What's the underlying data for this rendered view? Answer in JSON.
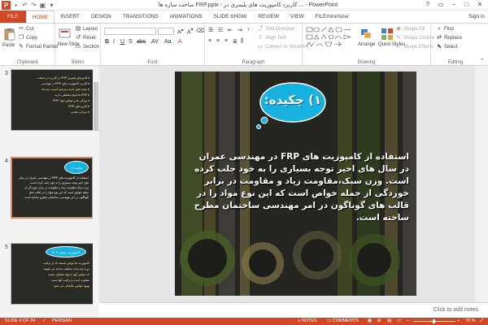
{
  "window": {
    "title": "ساخت سازه ها FRP.pptx - کاربرد کامپوزیت های پلیمری در ... - PowerPoint",
    "app_icon": "P"
  },
  "tabs": [
    "FILE",
    "HOME",
    "INSERT",
    "DESIGN",
    "TRANSITIONS",
    "ANIMATIONS",
    "SLIDE SHOW",
    "REVIEW",
    "VIEW",
    "FILEminimizer"
  ],
  "signin": "Sign in",
  "ribbon": {
    "clipboard": {
      "label": "Clipboard",
      "paste": "Paste",
      "cut": "Cut",
      "copy": "Copy",
      "format_painter": "Format Painter"
    },
    "slides": {
      "label": "Slides",
      "new_slide": "New Slide",
      "layout": "Layout",
      "reset": "Reset",
      "section": "Section"
    },
    "font": {
      "label": "Font"
    },
    "paragraph": {
      "label": "Paragraph",
      "text_direction": "Text Direction",
      "align_text": "Align Text",
      "convert_smartart": "Convert to SmartArt"
    },
    "drawing": {
      "label": "Drawing",
      "arrange": "Arrange",
      "quick_styles": "Quick Styles",
      "shape_fill": "Shape Fill",
      "shape_outline": "Shape Outline",
      "shape_effects": "Shape Effects"
    },
    "editing": {
      "label": "Editing",
      "find": "Find",
      "replace": "Replace",
      "select": "Select"
    }
  },
  "thumbnails": [
    {
      "num": "3",
      "lines": [
        "♦ فایبرهای پلیمری FRP در کاربرد در صنعت...",
        "♦ کاربرد کامپوزیت های FRP در مهندسی",
        "♦ سازه های جدید و ترمیم آسیب دیده ها",
        "♦ FRP ها انواع مختلفی دارند",
        "♦ ویژگی ها و خواص مواد FRP",
        "♦ کاربردهای FRP",
        "♦ مزایا و معایب"
      ]
    },
    {
      "num": "4",
      "bubble": "۱) چکیده",
      "lines": [
        "استفاده از کامپوزیت های FRP در مهندسی عمران در سال",
        "های اخیر توجه بسیاری را به خود جلب کرده است.",
        "وزن سبک،مقاومت زیاد و مقاومت در برابر خوردگی از",
        "جمله خواص است که این نوع مواد را در قالب های",
        "گوناگون در امر مهندسی ساختمان مطرح ساخته است."
      ]
    },
    {
      "num": "5",
      "bubble": "۲) کامپوزیت چیست؟",
      "lines": [
        "کامپوزیت ها موادی هستند که از ترکیب",
        "دو یا چند ماده مختلف ساخته می شوند",
        "که خواص آنها با مواد تشکیل دهنده",
        "متفاوت است و ترکیب آنها سبب",
        "بهبود خواص مکانیکی می شود."
      ]
    }
  ],
  "slide": {
    "bubble_title": "۱) چکیده:",
    "body": "استفاده از کامپوزیت های FRP در مهندسی عمران در سال های اخیر توجه بسیاری را به خود جلب کرده است. وزن سبک،مقاومت زیاد و مقاومت در برابر خوردگی از جمله خواص است که این نوع مواد را در قالب های گوناگون در امر مهندسی ساختمان مطرح ساخته است."
  },
  "notes_placeholder": "Click to add notes",
  "status": {
    "slide_info": "SLIDE 4 OF 34",
    "language": "PERSIAN",
    "notes": "NOTES",
    "comments": "COMMENTS",
    "zoom": "70 %"
  },
  "colors": {
    "accent": "#d24726",
    "bubble": "#18b2e0"
  }
}
